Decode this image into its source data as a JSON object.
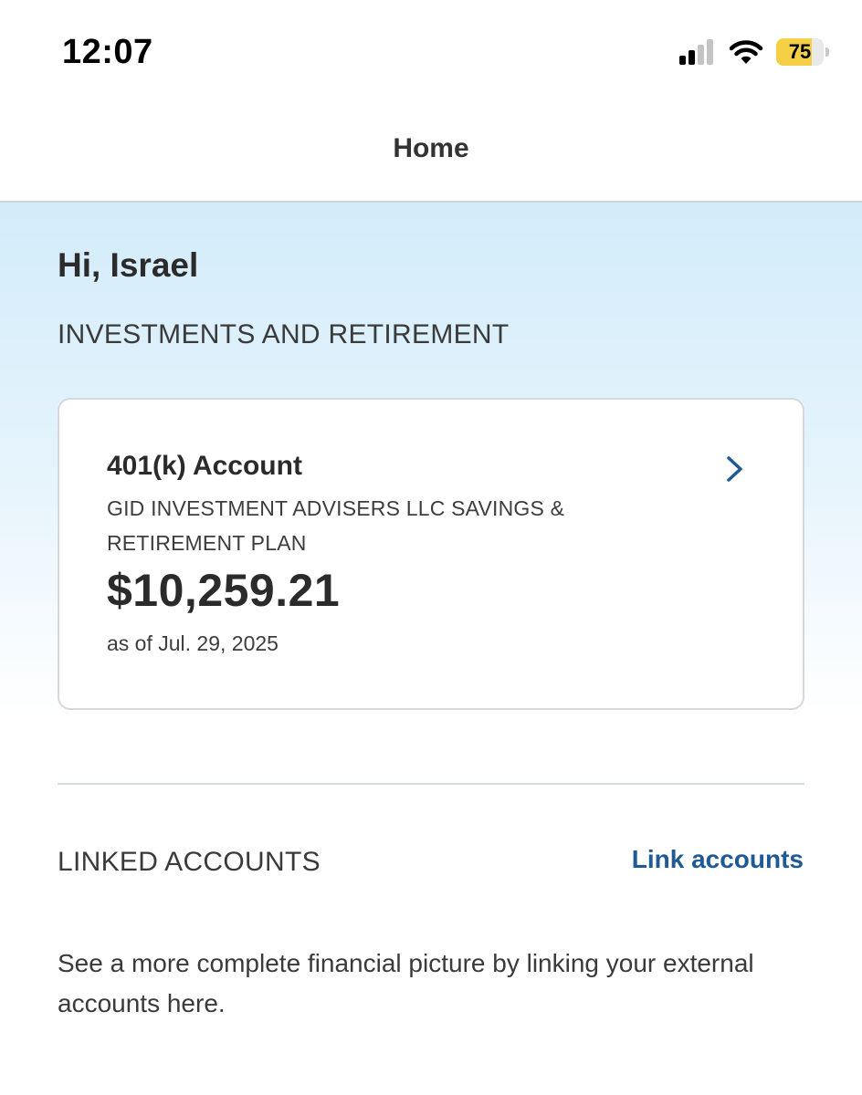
{
  "status_bar": {
    "time": "12:07",
    "battery_level": "75",
    "battery_fraction": 0.75,
    "battery_color": "#f5cf46",
    "icons": [
      "cellular-signal-icon",
      "wifi-icon",
      "battery-icon"
    ]
  },
  "header": {
    "title": "Home"
  },
  "greeting": "Hi, Israel",
  "investments": {
    "heading": "INVESTMENTS AND RETIREMENT",
    "account": {
      "title": "401(k) Account",
      "plan_name": "GID INVESTMENT ADVISERS LLC SAVINGS & RETIREMENT PLAN",
      "balance": "$10,259.21",
      "as_of": "as of Jul. 29, 2025",
      "icon": "chevron-right-icon"
    }
  },
  "linked_accounts": {
    "heading": "LINKED ACCOUNTS",
    "link_label": "Link accounts",
    "description": "See a more complete financial picture by linking your external accounts here."
  },
  "colors": {
    "link": "#1f5a94",
    "chevron": "#1f5a94",
    "gradient_top": "#d3ecfa"
  }
}
